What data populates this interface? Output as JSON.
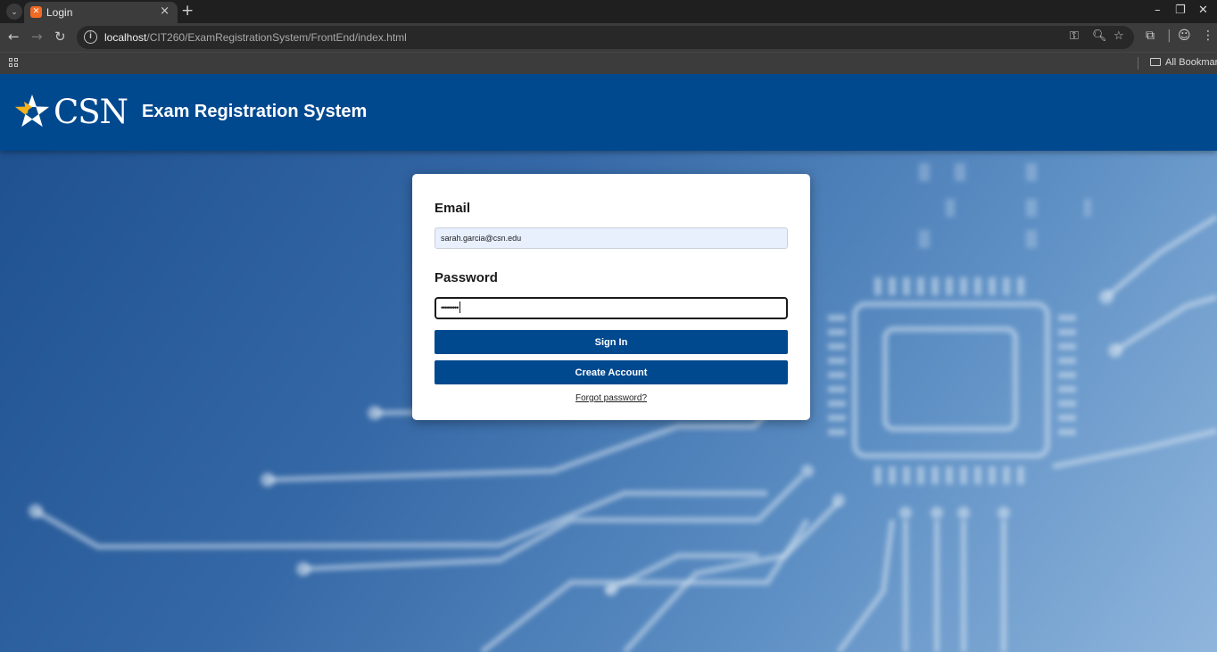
{
  "browser": {
    "tab_title": "Login",
    "tab_favicon": "xampp-favicon-icon",
    "close_glyph": "×",
    "new_tab_glyph": "+",
    "url_host": "localhost",
    "url_path": "/CIT260/ExamRegistrationSystem/FrontEnd/index.html",
    "bookmarks_label": "All Bookmarks"
  },
  "header": {
    "logo_text": "CSN",
    "title": "Exam Registration System"
  },
  "login": {
    "email_label": "Email",
    "email_value": "sarah.garcia@csn.edu",
    "password_label": "Password",
    "password_masked": "•••••••••",
    "sign_in_label": "Sign In",
    "create_account_label": "Create Account",
    "forgot_password_label": "Forgot password?"
  },
  "colors": {
    "brand_blue": "#00498f",
    "logo_gold": "#f6b21b",
    "autofill_bg": "#e8f0fe"
  }
}
